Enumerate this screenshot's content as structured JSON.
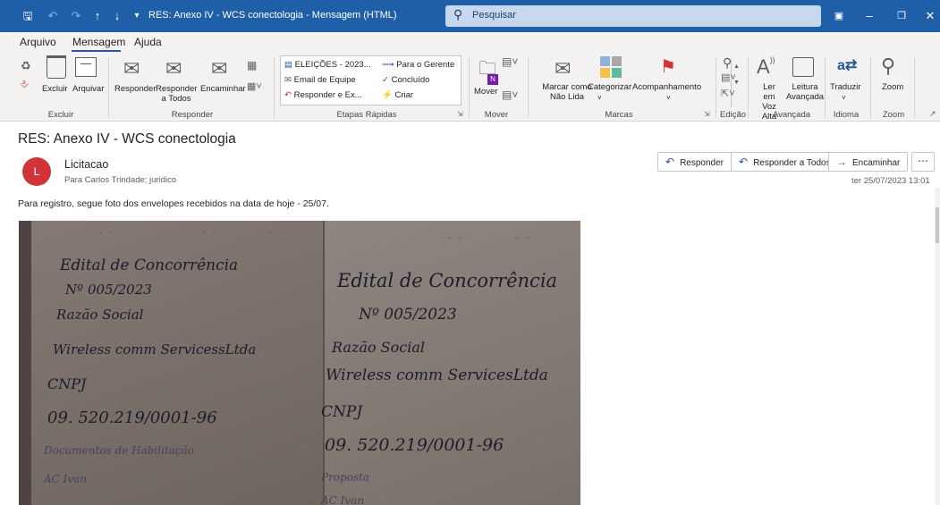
{
  "titlebar": {
    "title": "RES: Anexo IV - WCS conectologia  -  Mensagem (HTML)",
    "search_placeholder": "Pesquisar",
    "icons": [
      "save-icon",
      "undo-icon",
      "redo-icon",
      "up-arrow-icon",
      "down-arrow-icon",
      "customize-icon"
    ]
  },
  "tabs": [
    "Arquivo",
    "Mensagem",
    "Ajuda"
  ],
  "ribbon": {
    "groups": {
      "excluir": {
        "label": "Excluir",
        "buttons": [
          "Excluir",
          "Arquivar"
        ]
      },
      "responder": {
        "label": "Responder",
        "buttons": [
          "Responder",
          "Responder a Todos",
          "Encaminhar"
        ]
      },
      "etapas": {
        "label": "Etapas Rápidas",
        "items": [
          "ELEIÇÕES - 2023...",
          "Para o Gerente",
          "Email de Equipe",
          "Concluído",
          "Responder e Ex...",
          "Criar"
        ]
      },
      "mover": {
        "label": "Mover",
        "buttons": [
          "Mover"
        ]
      },
      "marcas": {
        "label": "Marcas",
        "buttons": [
          "Marcar como Não Lida",
          "Categorizar",
          "Acompanhamento"
        ]
      },
      "edicao": {
        "label": "Edição"
      },
      "avancada": {
        "label": "Avançada",
        "buttons": [
          "Ler em Voz Alta",
          "Leitura Avançada"
        ]
      },
      "idioma": {
        "label": "Idioma",
        "buttons": [
          "Traduzir"
        ]
      },
      "zoom": {
        "label": "Zoom",
        "buttons": [
          "Zoom"
        ]
      }
    }
  },
  "message": {
    "subject": "RES: Anexo IV - WCS conectologia",
    "avatar_initial": "L",
    "avatar_color": "#d13438",
    "sender": "Licitacao",
    "recipients": "Para   Carlos Trindade; juridico",
    "actions": [
      "Responder",
      "Responder a Todos",
      "Encaminhar"
    ],
    "datetime": "ter 25/07/2023 13:01",
    "body": "Para registro, segue foto dos envelopes recebidos na data de hoje - 25/07."
  },
  "photo": {
    "left_envelope": [
      "Edital de Concorrência",
      "Nº 005/2023",
      "Razão Social",
      "Wireless comm ServicessLtda",
      "CNPJ",
      "09. 520.219/0001-96",
      "Documentos de Habilitação",
      "AC Ivan"
    ],
    "right_envelope": [
      "Edital de Concorrência",
      "Nº 005/2023",
      "Razão Social",
      "Wireless comm ServicesLtda",
      "CNPJ",
      "09. 520.219/0001-96",
      "Proposta",
      "AC Ivan"
    ]
  }
}
